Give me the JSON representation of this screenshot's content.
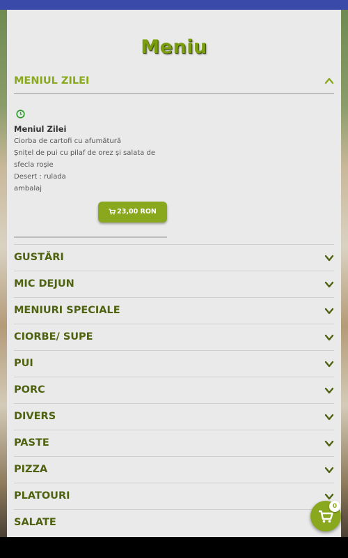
{
  "page": {
    "title": "Meniu"
  },
  "colors": {
    "accent": "#8aa81e",
    "category_text": "#4f6210",
    "topbar": "#3a4aa8"
  },
  "open_section": {
    "label": "MENIUL ZILEI",
    "icon": "chevron-up-icon",
    "item": {
      "icon": "clock-icon",
      "title": "Meniul Zilei",
      "description_lines": [
        "Ciorba de cartofi cu afumătură",
        "Șnițel de pui cu pilaf de orez și salata de",
        "sfecla roșie",
        "Desert : rulada",
        "ambalaj"
      ],
      "price": "23,00 RON",
      "price_icon": "cart-icon"
    }
  },
  "categories": [
    {
      "label": "GUSTĂRI"
    },
    {
      "label": "MIC DEJUN"
    },
    {
      "label": "MENIURI SPECIALE"
    },
    {
      "label": "CIORBE/ SUPE"
    },
    {
      "label": "PUI"
    },
    {
      "label": "PORC"
    },
    {
      "label": "DIVERS"
    },
    {
      "label": "PASTE"
    },
    {
      "label": "PIZZA"
    },
    {
      "label": "PLATOURI"
    },
    {
      "label": "SALATE"
    }
  ],
  "cart": {
    "count": "0",
    "icon": "cart-icon"
  }
}
